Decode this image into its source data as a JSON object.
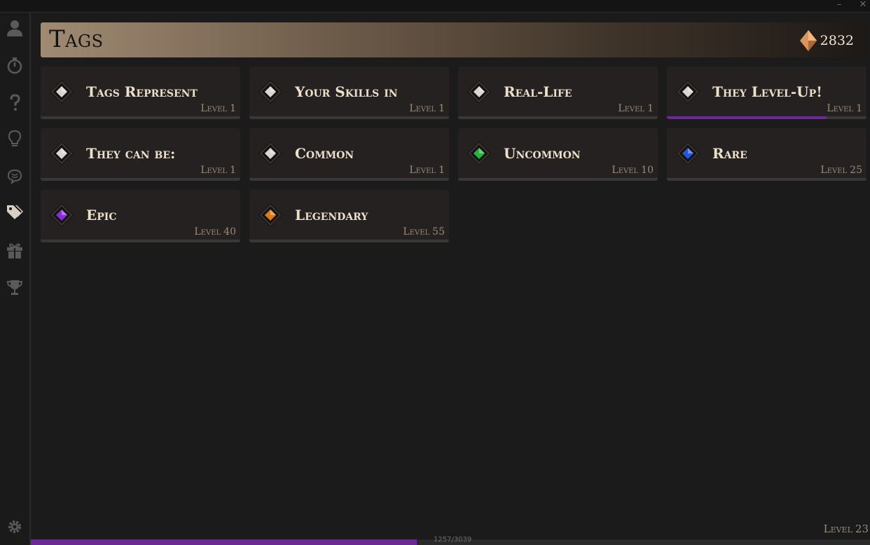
{
  "window": {
    "minimize_glyph": "–",
    "close_glyph": "✕"
  },
  "sidebar": {
    "items": [
      {
        "icon": "user-icon",
        "active": false
      },
      {
        "icon": "stopwatch-icon",
        "active": false
      },
      {
        "icon": "question-icon",
        "active": false
      },
      {
        "icon": "lightbulb-icon",
        "active": false
      },
      {
        "icon": "brain-icon",
        "active": false
      },
      {
        "icon": "tags-icon",
        "active": true
      },
      {
        "icon": "gift-icon",
        "active": false
      },
      {
        "icon": "trophy-icon",
        "active": false
      }
    ],
    "settings_icon": "gear-icon"
  },
  "header": {
    "title": "Tags",
    "currency_amount": "2832",
    "currency_icon": "crystal-icon"
  },
  "level_prefix": "Level",
  "rarity_colors": {
    "common": "#d9d6d2",
    "uncommon": "#1fb83a",
    "rare": "#2456e0",
    "epic": "#8a2be2",
    "legendary": "#e07a12"
  },
  "tags": [
    {
      "name": "Tags Represent",
      "level": "1",
      "rarity": "common",
      "progress": 0
    },
    {
      "name": "Your Skills in",
      "level": "1",
      "rarity": "common",
      "progress": 0
    },
    {
      "name": "Real-Life",
      "level": "1",
      "rarity": "common",
      "progress": 0
    },
    {
      "name": "They Level-Up!",
      "level": "1",
      "rarity": "common",
      "progress": 0.8
    },
    {
      "name": "They can be:",
      "level": "1",
      "rarity": "common",
      "progress": 0
    },
    {
      "name": "Common",
      "level": "1",
      "rarity": "common",
      "progress": 0
    },
    {
      "name": "Uncommon",
      "level": "10",
      "rarity": "uncommon",
      "progress": 0
    },
    {
      "name": "Rare",
      "level": "25",
      "rarity": "rare",
      "progress": 0
    },
    {
      "name": "Epic",
      "level": "40",
      "rarity": "epic",
      "progress": 0
    },
    {
      "name": "Legendary",
      "level": "55",
      "rarity": "legendary",
      "progress": 0
    }
  ],
  "footer": {
    "level": "23",
    "xp_text": "1257/3039",
    "xp_progress": 0.46
  }
}
